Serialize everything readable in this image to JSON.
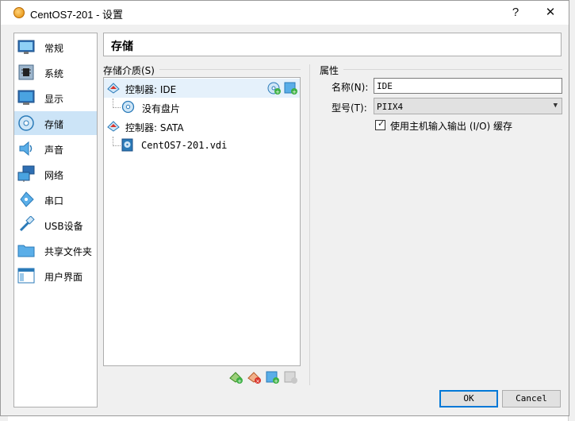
{
  "window": {
    "title": "CentOS7-201 - 设置",
    "help_label": "?",
    "close_label": "✕"
  },
  "colors": {
    "accent": "#0078d7",
    "selection": "#cce4f7",
    "add_green": "#3cb043",
    "remove_red": "#d9342b",
    "disk_blue": "#2a7ab8"
  },
  "nav": {
    "items": [
      {
        "label": "常规",
        "icon": "general-monitor-icon"
      },
      {
        "label": "系统",
        "icon": "system-chip-icon"
      },
      {
        "label": "显示",
        "icon": "display-monitor-icon"
      },
      {
        "label": "存储",
        "icon": "storage-disk-icon",
        "active": true
      },
      {
        "label": "声音",
        "icon": "audio-speaker-icon"
      },
      {
        "label": "网络",
        "icon": "network-icon"
      },
      {
        "label": "串口",
        "icon": "serial-port-icon"
      },
      {
        "label": "USB设备",
        "icon": "usb-icon"
      },
      {
        "label": "共享文件夹",
        "icon": "shared-folder-icon"
      },
      {
        "label": "用户界面",
        "icon": "user-interface-icon"
      }
    ]
  },
  "page": {
    "title": "存储"
  },
  "storage": {
    "label": "存储介质(S)",
    "tree": [
      {
        "label": "控制器: IDE",
        "type": "controller",
        "selected": true
      },
      {
        "label": "没有盘片",
        "type": "optical"
      },
      {
        "label": "控制器: SATA",
        "type": "controller"
      },
      {
        "label": "CentOS7-201.vdi",
        "type": "hard-disk"
      }
    ]
  },
  "properties": {
    "section_label": "属性",
    "name_label": "名称(N):",
    "name_value": "IDE",
    "type_label": "型号(T):",
    "type_value": "PIIX4",
    "cache_label": "使用主机输入输出 (I/O) 缓存",
    "cache_checked": true
  },
  "buttons": {
    "ok": "OK",
    "cancel": "Cancel"
  }
}
